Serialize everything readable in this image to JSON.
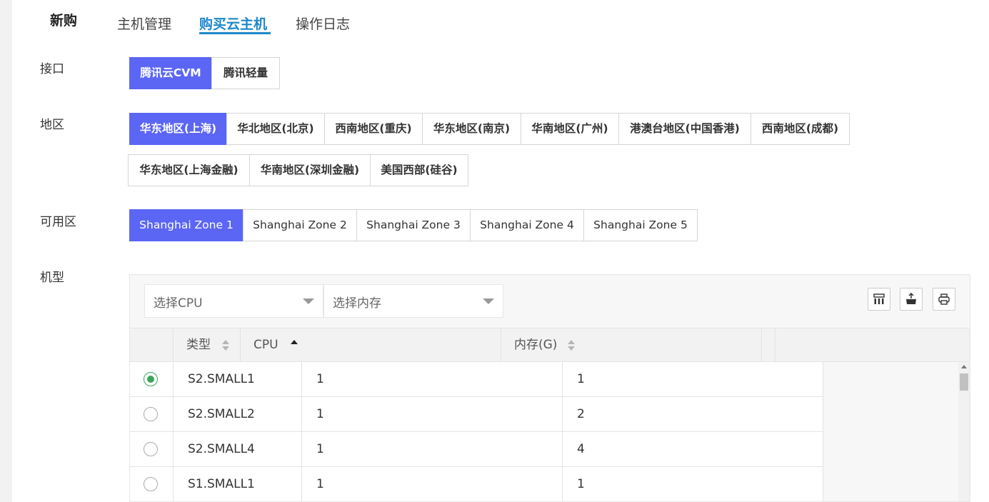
{
  "nav": {
    "new": "新购",
    "tabs": [
      {
        "label": "主机管理",
        "active": false
      },
      {
        "label": "购买云主机",
        "active": true
      },
      {
        "label": "操作日志",
        "active": false
      }
    ]
  },
  "interface": {
    "label": "接口",
    "options": [
      "腾讯云CVM",
      "腾讯轻量"
    ],
    "selected": "腾讯云CVM"
  },
  "region": {
    "label": "地区",
    "options_row1": [
      "华东地区(上海)",
      "华北地区(北京)",
      "西南地区(重庆)",
      "华东地区(南京)",
      "华南地区(广州)",
      "港澳台地区(中国香港)",
      "西南地区(成都)"
    ],
    "options_row2": [
      "华东地区(上海金融)",
      "华南地区(深圳金融)",
      "美国西部(硅谷)"
    ],
    "selected": "华东地区(上海)"
  },
  "zone": {
    "label": "可用区",
    "options": [
      "Shanghai Zone 1",
      "Shanghai Zone 2",
      "Shanghai Zone 3",
      "Shanghai Zone 4",
      "Shanghai Zone 5"
    ],
    "selected": "Shanghai Zone 1"
  },
  "machine": {
    "label": "机型",
    "filters": {
      "cpu_placeholder": "选择CPU",
      "memory_placeholder": "选择内存"
    },
    "toolbar_icons": [
      "columns-icon",
      "export-icon",
      "print-icon"
    ],
    "columns": [
      {
        "label": "类型",
        "sort": "none"
      },
      {
        "label": "CPU",
        "sort": "asc"
      },
      {
        "label": "内存(G)",
        "sort": "none"
      }
    ],
    "rows": [
      {
        "type": "S2.SMALL1",
        "cpu": "1",
        "memory": "1",
        "selected": true
      },
      {
        "type": "S2.SMALL2",
        "cpu": "1",
        "memory": "2",
        "selected": false
      },
      {
        "type": "S2.SMALL4",
        "cpu": "1",
        "memory": "4",
        "selected": false
      },
      {
        "type": "S1.SMALL1",
        "cpu": "1",
        "memory": "1",
        "selected": false
      }
    ]
  },
  "colors": {
    "accent_tab": "#1e88c9",
    "selected_button": "#5b66f5",
    "radio_checked": "#3aa55a"
  }
}
